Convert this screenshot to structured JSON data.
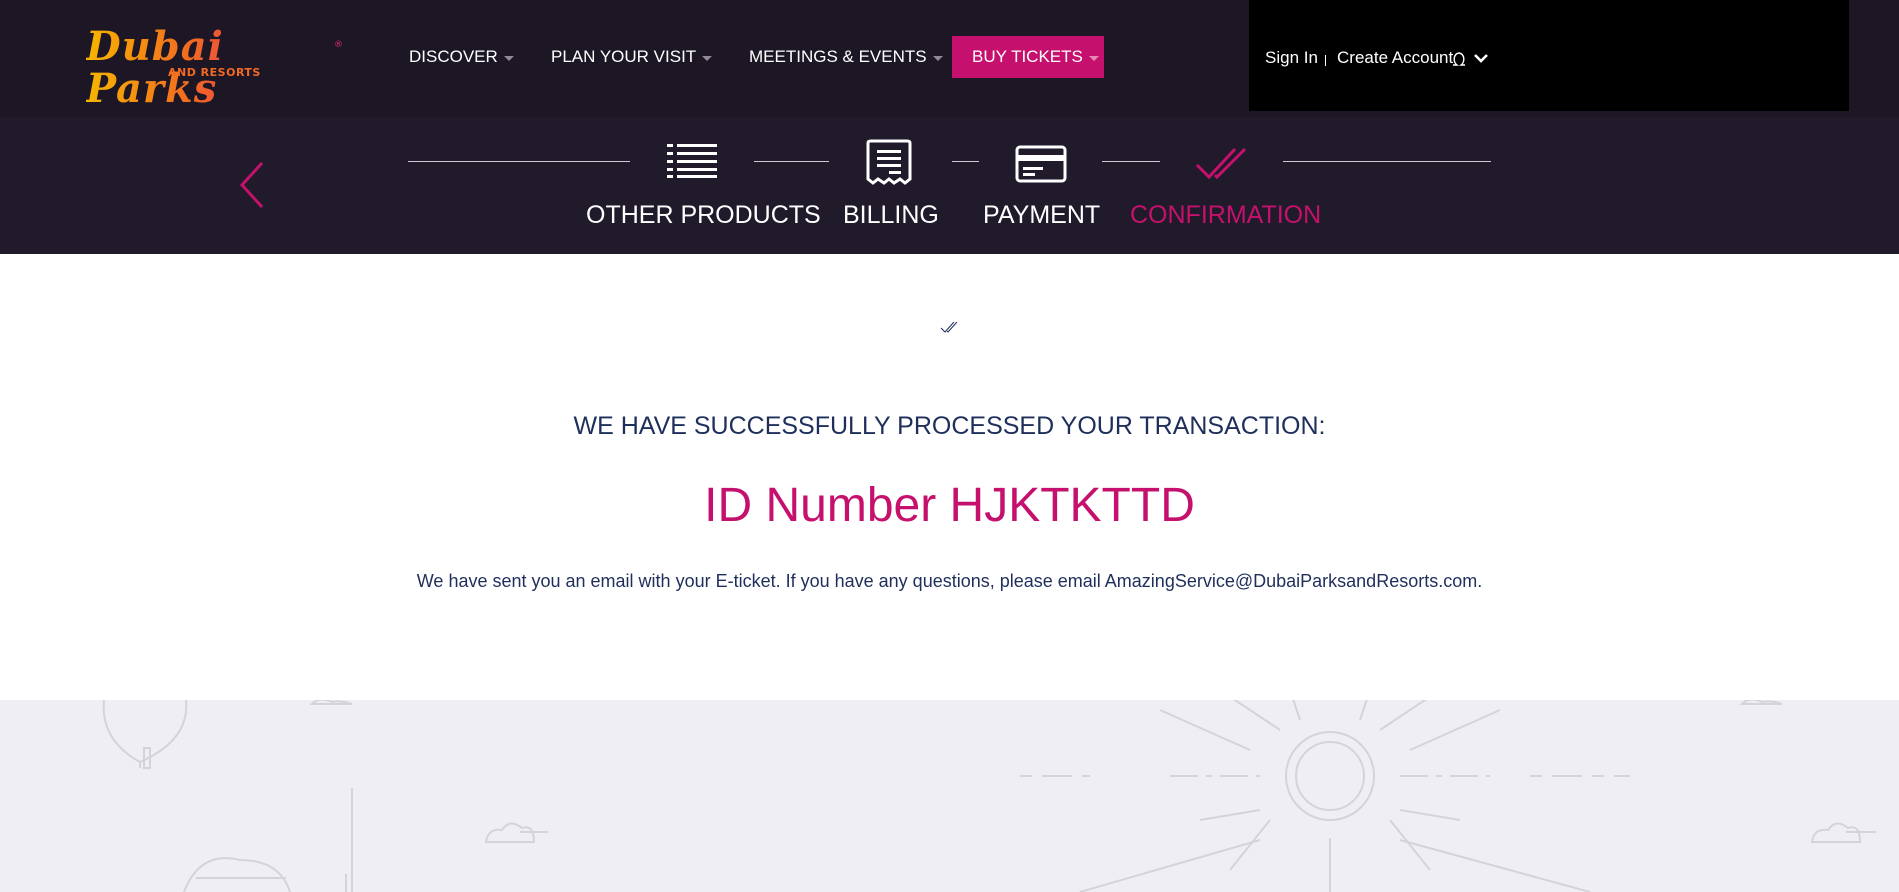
{
  "header": {
    "logo": {
      "name": "Dubai Parks",
      "sub": "AND RESORTS",
      "tm": "®"
    },
    "nav": [
      {
        "label": "DISCOVER"
      },
      {
        "label": "PLAN YOUR VISIT"
      },
      {
        "label": "MEETINGS & EVENTS"
      },
      {
        "label": "BUY TICKETS"
      }
    ],
    "account": {
      "sign_in": "Sign In",
      "create_account": "Create Account"
    }
  },
  "steps": [
    {
      "label": "OTHER PRODUCTS",
      "icon": "list-icon",
      "active": false
    },
    {
      "label": "BILLING",
      "icon": "receipt-icon",
      "active": false
    },
    {
      "label": "PAYMENT",
      "icon": "credit-card-icon",
      "active": false
    },
    {
      "label": "CONFIRMATION",
      "icon": "double-check-icon",
      "active": true
    }
  ],
  "confirmation": {
    "heading": "WE HAVE SUCCESSFULLY PROCESSED YOUR TRANSACTION:",
    "id_text": "ID Number HJKTKTTD",
    "message": "We have sent you an email with your E-ticket. If you have any questions, please email AmazingService@DubaiParksandResorts.com."
  },
  "colors": {
    "header_bg": "#1d1625",
    "steps_bg": "#211a2b",
    "accent": "#c5116d",
    "text_navy": "#1f2f5c",
    "footer_bg": "#efeff3"
  }
}
